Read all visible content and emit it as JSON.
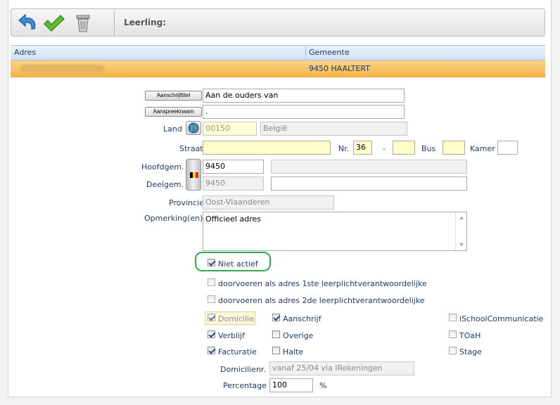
{
  "toolbar": {
    "undo_icon": "undo-arrow-icon",
    "save_icon": "checkmark-icon",
    "trash_icon": "trash-can-icon",
    "title": "Leerling:"
  },
  "grid": {
    "columns": [
      "Adres",
      "Gemeente"
    ],
    "row": {
      "adres": "",
      "gemeente": "9450 HAALTERT"
    }
  },
  "form": {
    "aanschrijftitel_btn": "Aanschrijftitel",
    "aanschrijftitel_value": "Aan de ouders van",
    "aanspreeknaam_btn": "Aanspreeknaam",
    "aanspreeknaam_value": ".",
    "land_label": "Land",
    "land_code": "00150",
    "land_name": "België",
    "straat_label": "Straat",
    "straat_value": "",
    "nr_label": "Nr.",
    "nr_value": "36",
    "dash": "-",
    "nr2_value": "",
    "bus_label": "Bus",
    "bus_value": "",
    "kamer_label": "Kamer",
    "kamer_value": "",
    "hoofdgem_label": "Hoofdgem.",
    "hoofdgem_value": "9450",
    "hoofdgem_name": "",
    "deelgem_label": "Deelgem.",
    "deelgem_value": "9450",
    "deelgem_name": "",
    "provincie_label": "Provincie",
    "provincie_value": "Oost-Vlaanderen",
    "opmerking_label": "Opmerking(en)",
    "opmerking_value": "Officieel adres",
    "niet_actief": "Niet actief",
    "doorvoeren1": "doorvoeren als adres 1ste leerplichtverantwoordelijke",
    "doorvoeren2": "doorvoeren als adres 2de leerplichtverantwoordelijke",
    "domicilie": "Domicilie",
    "aanschrijf": "Aanschrijf",
    "ischool": "iSchoolCommunicatie",
    "verblijf": "Verblijf",
    "overige": "Overige",
    "toah": "TOaH",
    "facturatie": "Facturatie",
    "halte": "Halte",
    "stage": "Stage",
    "domicilienr_label": "Domicilienr.",
    "domicilienr_value": "vanaf 25/04 via iRekeningen",
    "percentage_label": "Percentage",
    "percentage_value": "100",
    "percent_sign": "%"
  },
  "colors": {
    "selected_row": "#f5b447",
    "highlight_oval": "#2fa84f",
    "required_field": "#ffffc8"
  }
}
